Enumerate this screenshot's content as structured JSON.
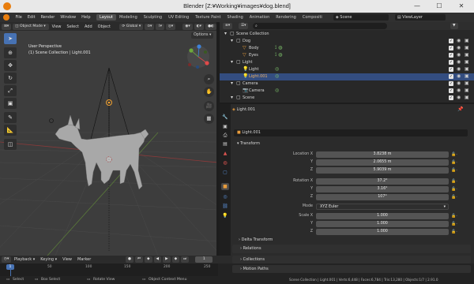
{
  "window": {
    "title": "Blender [Z:¥Working¥images¥dog.blend]",
    "minimize": "—",
    "maximize": "☐",
    "close": "✕"
  },
  "menu": [
    "File",
    "Edit",
    "Render",
    "Window",
    "Help"
  ],
  "workspaces": [
    "Layout",
    "Modeling",
    "Sculpting",
    "UV Editing",
    "Texture Paint",
    "Shading",
    "Animation",
    "Rendering",
    "Compositi"
  ],
  "active_workspace": "Layout",
  "scene": {
    "label": "Scene",
    "view_layer": "ViewLayer"
  },
  "viewport": {
    "mode": "Object Mode",
    "header_menus": [
      "View",
      "Select",
      "Add",
      "Object"
    ],
    "transform": "Global",
    "info_line1": "User Perspective",
    "info_line2": "(1) Scene Collection | Light.001",
    "options": "Options"
  },
  "outliner": {
    "rows": [
      {
        "label": "Scene Collection",
        "indent": 0,
        "type": "collection",
        "selected": false
      },
      {
        "label": "Dog",
        "indent": 1,
        "type": "collection",
        "selected": false
      },
      {
        "label": "Body",
        "indent": 2,
        "type": "mesh",
        "selected": false
      },
      {
        "label": "Eyes",
        "indent": 2,
        "type": "mesh",
        "selected": false
      },
      {
        "label": "Light",
        "indent": 1,
        "type": "collection",
        "selected": false
      },
      {
        "label": "Light",
        "indent": 2,
        "type": "light",
        "selected": false
      },
      {
        "label": "Light.001",
        "indent": 2,
        "type": "light",
        "selected": true
      },
      {
        "label": "Camera",
        "indent": 1,
        "type": "collection",
        "selected": false
      },
      {
        "label": "Camera",
        "indent": 2,
        "type": "camera",
        "selected": false
      },
      {
        "label": "Scene",
        "indent": 1,
        "type": "collection",
        "selected": false
      }
    ]
  },
  "properties": {
    "breadcrumb": "Light.001",
    "object_name": "Light.001",
    "transform_title": "Transform",
    "location": {
      "label": "Location X",
      "x": "3.8238 m",
      "y": "2.0655 m",
      "z": "5.9039 m"
    },
    "rotation": {
      "label": "Rotation X",
      "x": "37.2°",
      "y": "3.16°",
      "z": "107°"
    },
    "mode": {
      "label": "Mode",
      "value": "XYZ Euler"
    },
    "scale": {
      "label": "Scale X",
      "x": "1.000",
      "y": "1.000",
      "z": "1.000"
    },
    "axis_y": "Y",
    "axis_z": "Z",
    "delta": "Delta Transform",
    "sections": [
      "Relations",
      "Collections",
      "Motion Paths"
    ]
  },
  "timeline": {
    "menus": [
      "Playback",
      "Keying",
      "View",
      "Marker"
    ],
    "current_frame": "1",
    "ticks": [
      "0",
      "50",
      "100",
      "150",
      "200",
      "250"
    ],
    "start": "1",
    "end": "250"
  },
  "statusbar": {
    "select": "Select",
    "box_select": "Box Select",
    "rotate": "Rotate View",
    "context": "Object Context Menu",
    "stats": "Scene Collection | Light.001 | Verts:6,448 | Faces:6,784 | Tris:13,280 | Objects:1/7 | 2.91.0"
  }
}
